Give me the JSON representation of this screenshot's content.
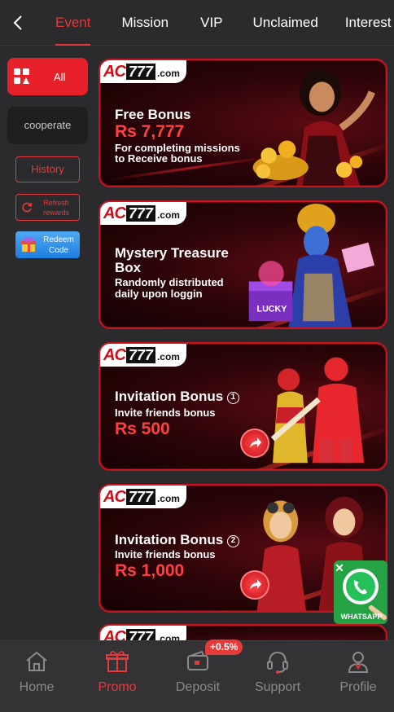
{
  "nav": {
    "tabs": [
      "Event",
      "Mission",
      "VIP",
      "Unclaimed",
      "Interest"
    ],
    "active_tab": "Event"
  },
  "sidebar": {
    "all_label": "All",
    "cooperate_label": "cooperate",
    "history_label": "History",
    "refresh_label": "Refresh rewards",
    "redeem_label": "Redeem Code"
  },
  "brand": {
    "ac": "AC",
    "num": "777",
    "com": ".com"
  },
  "banners": [
    {
      "title": "Free Bonus",
      "amount": "Rs 7,777",
      "line1": "For completing missions",
      "line2": "to Receive bonus"
    },
    {
      "title1": "Mystery Treasure",
      "title2": "Box",
      "line1": "Randomly distributed",
      "line2": "daily upon loggin",
      "box_text": "LUCKY BOX"
    },
    {
      "title": "Invitation Bonus",
      "badge": "1",
      "line1": "Invite friends bonus",
      "amount": "Rs 500"
    },
    {
      "title": "Invitation Bonus",
      "badge": "2",
      "line1": "Invite friends bonus",
      "amount": "Rs 1,000"
    }
  ],
  "whatsapp": {
    "label": "WHATSAPP",
    "close": "✕"
  },
  "bottom_nav": {
    "items": [
      "Home",
      "Promo",
      "Deposit",
      "Support",
      "Profile"
    ],
    "active": "Promo",
    "deposit_badge": "+0.5%"
  },
  "colors": {
    "accent": "#e63a3a",
    "bg": "#2b2b2d",
    "banner_border": "#c8141e"
  }
}
